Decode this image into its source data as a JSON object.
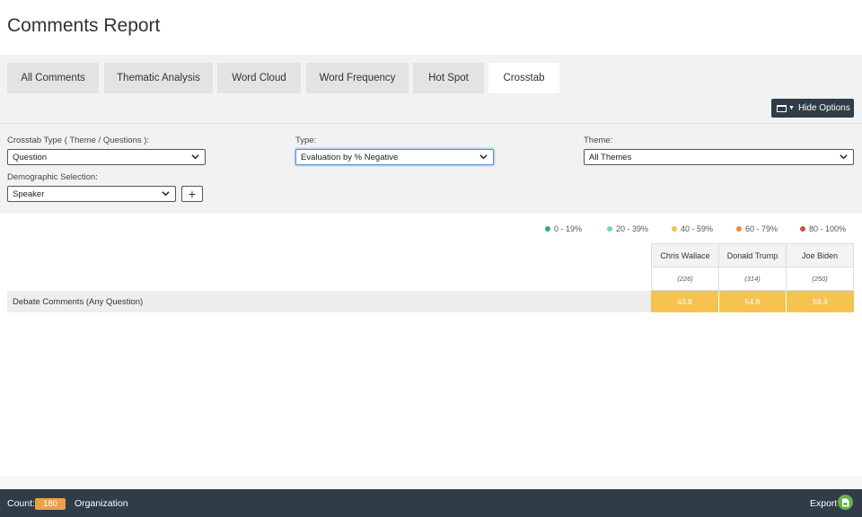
{
  "page": {
    "title": "Comments Report"
  },
  "tabs": [
    {
      "label": "All Comments"
    },
    {
      "label": "Thematic Analysis"
    },
    {
      "label": "Word Cloud"
    },
    {
      "label": "Word Frequency"
    },
    {
      "label": "Hot Spot"
    },
    {
      "label": "Crosstab",
      "active": true
    }
  ],
  "toolbar": {
    "hide_options_label": "Hide Options"
  },
  "options": {
    "crosstab_type": {
      "label": "Crosstab Type ( Theme / Questions ):",
      "value": "Question"
    },
    "type": {
      "label": "Type:",
      "value": "Evaluation by % Negative"
    },
    "theme": {
      "label": "Theme:",
      "value": "All Themes"
    },
    "demographic": {
      "label": "Demographic Selection:",
      "value": "Speaker"
    },
    "add_label": "+"
  },
  "legend": [
    {
      "label": "0 - 19%",
      "color": "#3aa870"
    },
    {
      "label": "20 - 39%",
      "color": "#6fd9a3"
    },
    {
      "label": "40 - 59%",
      "color": "#f3c14c"
    },
    {
      "label": "60 - 79%",
      "color": "#ea8c3a"
    },
    {
      "label": "80 - 100%",
      "color": "#d84a4a"
    }
  ],
  "crosstab": {
    "columns": [
      {
        "name": "Chris Wallace",
        "count": "(226)"
      },
      {
        "name": "Donald Trump",
        "count": "(314)"
      },
      {
        "name": "Joe Biden",
        "count": "(250)"
      }
    ],
    "rows": [
      {
        "label": "Debate Comments (Any Question)",
        "values": [
          "43.8",
          "54.8",
          "58.4"
        ]
      }
    ],
    "cell_color": "#f6c250"
  },
  "footer": {
    "count_label": "Count:",
    "count_value": "180",
    "org_label": "Organization",
    "export_label": "Export"
  }
}
